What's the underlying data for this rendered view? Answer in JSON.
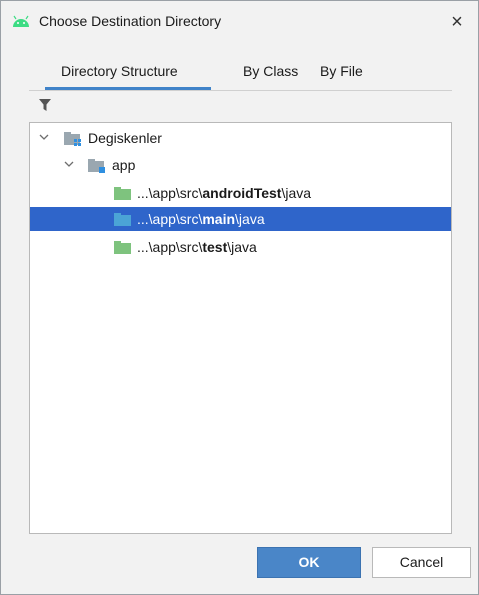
{
  "dialog": {
    "title": "Choose Destination Directory",
    "close_label": "×"
  },
  "tabs": [
    {
      "label": "Directory Structure",
      "selected": true
    },
    {
      "label": "By Class",
      "selected": false
    },
    {
      "label": "By File",
      "selected": false
    }
  ],
  "tree": {
    "nodes": [
      {
        "label": "Degiskenler",
        "expanded": true,
        "icon": "module-folder-icon"
      },
      {
        "label": "app",
        "expanded": true,
        "icon": "module-folder-icon"
      },
      {
        "prefix": "...\\app\\src\\",
        "bold": "androidTest",
        "suffix": "\\java",
        "icon": "test-source-folder-icon",
        "selected": false
      },
      {
        "prefix": "...\\app\\src\\",
        "bold": "main",
        "suffix": "\\java",
        "icon": "source-folder-icon",
        "selected": true
      },
      {
        "prefix": "...\\app\\src\\",
        "bold": "test",
        "suffix": "\\java",
        "icon": "test-source-folder-icon",
        "selected": false
      }
    ]
  },
  "buttons": {
    "ok": "OK",
    "cancel": "Cancel"
  },
  "colors": {
    "accent": "#4083c9",
    "selection": "#2f65ca",
    "test_folder": "#7ec37e",
    "source_folder": "#4ba4d6",
    "android_green": "#3ddc84"
  }
}
